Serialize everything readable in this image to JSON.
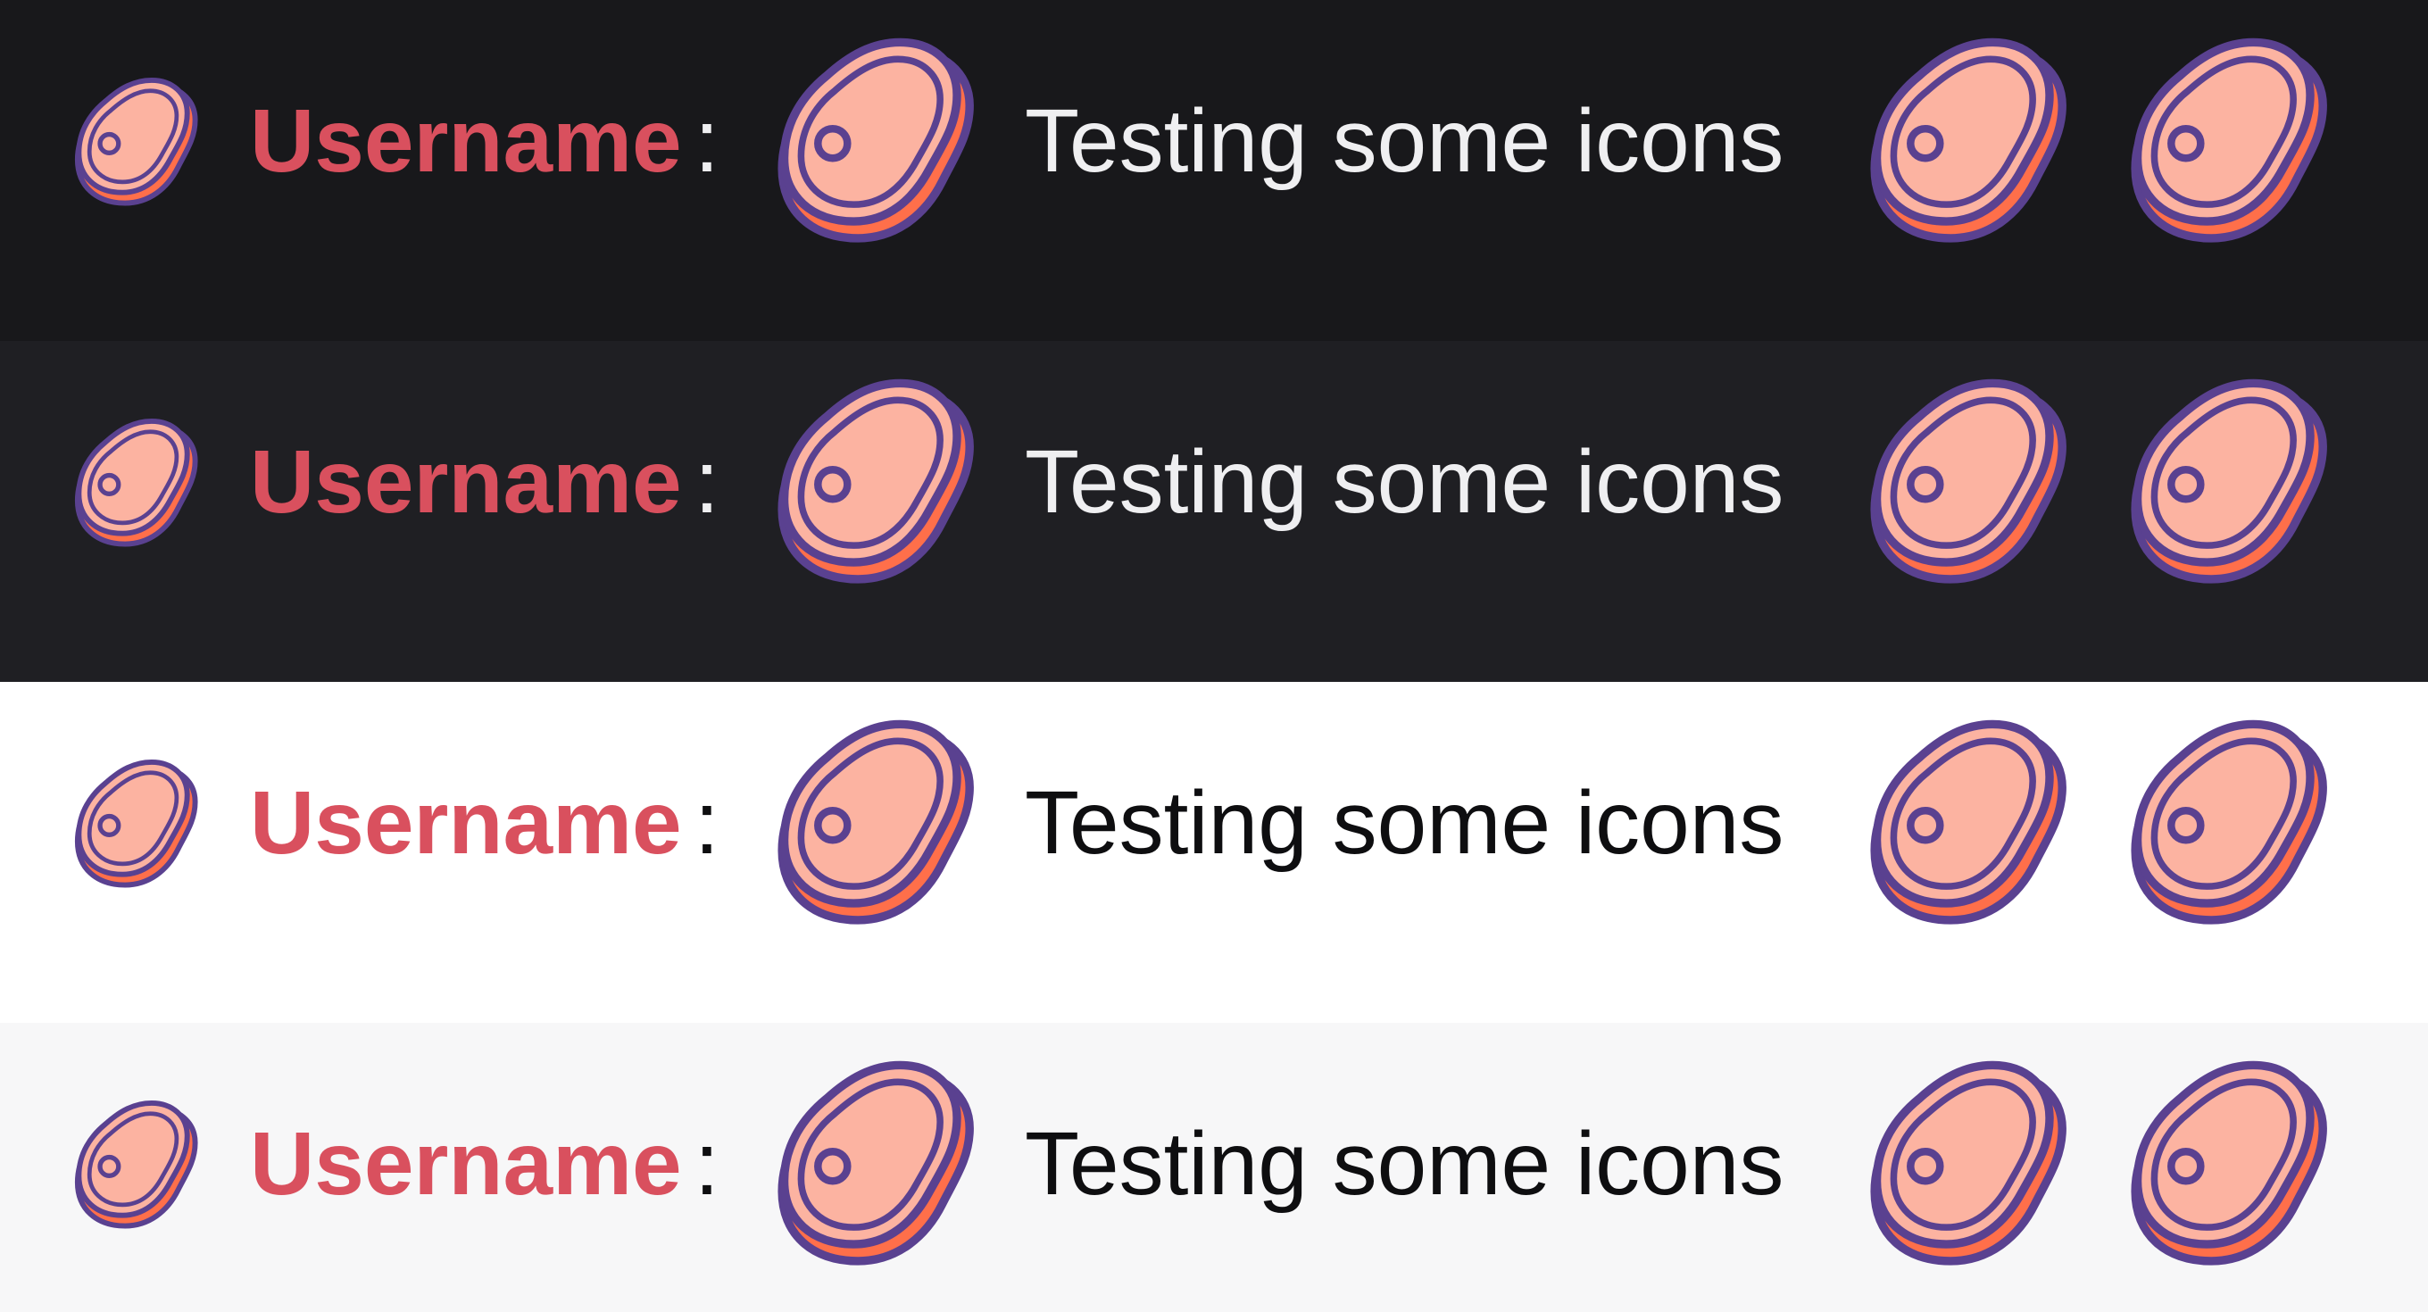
{
  "colors": {
    "username": "#d9505e",
    "meat_fill": "#fcb3a1",
    "meat_side": "#ff6f4a",
    "meat_outline": "#5a4190"
  },
  "rows": [
    {
      "theme": "dark",
      "background": "#18181b",
      "text_color": "#efeff1",
      "username": "Username",
      "separator": ":",
      "message": "Testing some icons",
      "badge_icon": "meat-icon",
      "emote_icon": "meat-icon"
    },
    {
      "theme": "dark-alt",
      "background": "#1f1f23",
      "text_color": "#efeff1",
      "username": "Username",
      "separator": ":",
      "message": "Testing some icons",
      "badge_icon": "meat-icon",
      "emote_icon": "meat-icon"
    },
    {
      "theme": "light",
      "background": "#ffffff",
      "text_color": "#0e0e10",
      "username": "Username",
      "separator": ":",
      "message": "Testing some icons",
      "badge_icon": "meat-icon",
      "emote_icon": "meat-icon"
    },
    {
      "theme": "light-alt",
      "background": "#f7f7f8",
      "text_color": "#0e0e10",
      "username": "Username",
      "separator": ":",
      "message": "Testing some icons",
      "badge_icon": "meat-icon",
      "emote_icon": "meat-icon"
    }
  ]
}
